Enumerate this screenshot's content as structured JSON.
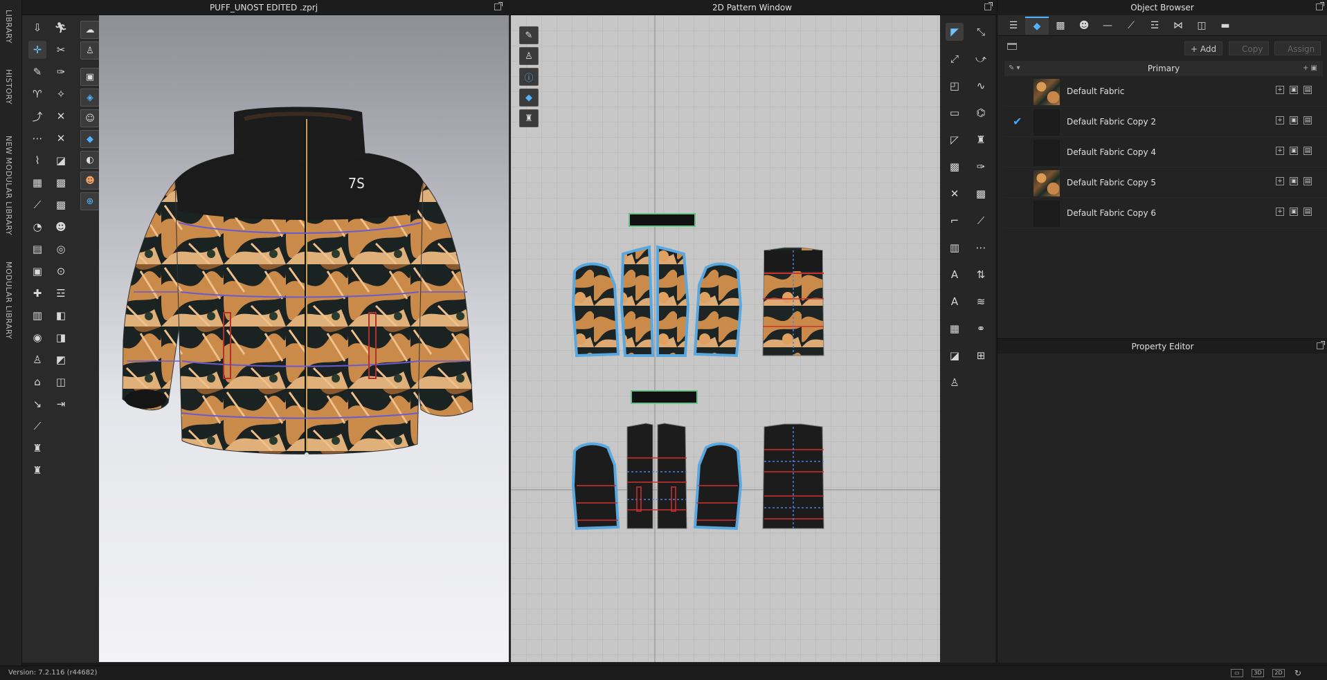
{
  "side_tabs": [
    "LIBRARY",
    "HISTORY",
    "NEW MODULAR LIBRARY",
    "MODULAR LIBRARY"
  ],
  "window3d": {
    "title": "PUFF_UNOST EDITED .zprj",
    "logo_text": "7S"
  },
  "window2d": {
    "title": "2D Pattern Window"
  },
  "object_browser": {
    "title": "Object Browser",
    "add_label": "+ Add",
    "copy_label": "Copy",
    "assign_label": "Assign",
    "group_label": "Primary",
    "fabrics": [
      {
        "name": "Default Fabric",
        "has_print": true,
        "checked": false
      },
      {
        "name": "Default Fabric Copy 2",
        "has_print": false,
        "checked": true
      },
      {
        "name": "Default Fabric Copy 4",
        "has_print": false,
        "checked": false
      },
      {
        "name": "Default Fabric Copy 5",
        "has_print": true,
        "checked": false
      },
      {
        "name": "Default Fabric Copy 6",
        "has_print": false,
        "checked": false
      }
    ]
  },
  "property_editor": {
    "title": "Property Editor"
  },
  "status": {
    "version": "Version: 7.2.116 (r44682)",
    "btn_3d": "3D",
    "btn_2d": "2D"
  },
  "colors": {
    "accent": "#4fb3ff",
    "pattern_outline": "#5aa8e0",
    "seam": "#d03030"
  }
}
